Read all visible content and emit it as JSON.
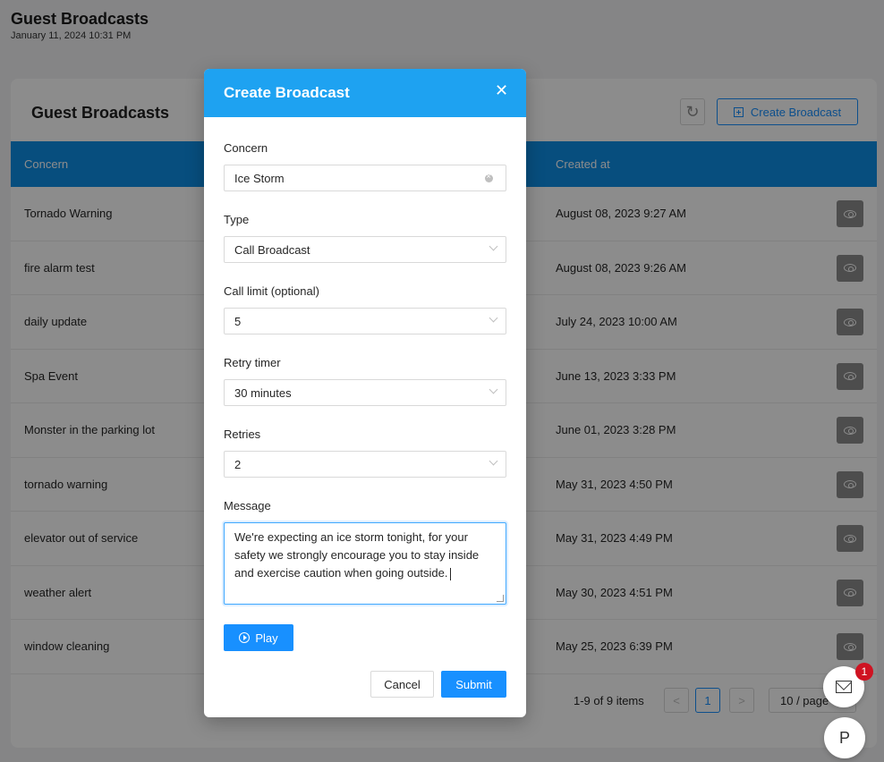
{
  "page": {
    "title": "Guest Broadcasts",
    "timestamp": "January 11, 2024 10:31 PM"
  },
  "card": {
    "title": "Guest Broadcasts",
    "create_label": "Create Broadcast",
    "columns": {
      "concern": "Concern",
      "created_at": "Created at"
    },
    "rows": [
      {
        "concern": "Tornado Warning",
        "created_at": "August 08, 2023 9:27 AM"
      },
      {
        "concern": "fire alarm test",
        "created_at": "August 08, 2023 9:26 AM"
      },
      {
        "concern": "daily update",
        "created_at": "July 24, 2023 10:00 AM"
      },
      {
        "concern": "Spa Event",
        "created_at": "June 13, 2023 3:33 PM"
      },
      {
        "concern": "Monster in the parking lot",
        "created_at": "June 01, 2023 3:28 PM"
      },
      {
        "concern": "tornado warning",
        "created_at": "May 31, 2023 4:50 PM"
      },
      {
        "concern": "elevator out of service",
        "created_at": "May 31, 2023 4:49 PM"
      },
      {
        "concern": "weather alert",
        "created_at": "May 30, 2023 4:51 PM"
      },
      {
        "concern": "window cleaning",
        "created_at": "May 25, 2023 6:39 PM"
      }
    ],
    "pagination": {
      "total": "1-9 of 9 items",
      "current": "1",
      "prev": "<",
      "next": ">",
      "page_size": "10 / page"
    }
  },
  "modal": {
    "title": "Create Broadcast",
    "close": "X",
    "concern_label": "Concern",
    "concern_value": "Ice Storm",
    "type_label": "Type",
    "type_value": "Call Broadcast",
    "call_limit_label": "Call limit (optional)",
    "call_limit_value": "5",
    "retry_timer_label": "Retry timer",
    "retry_timer_value": "30 minutes",
    "retries_label": "Retries",
    "retries_value": "2",
    "message_label": "Message",
    "message_value": "We're expecting an ice storm tonight, for your safety we strongly encourage you to stay inside and exercise caution when going outside.",
    "play_label": "Play",
    "cancel_label": "Cancel",
    "submit_label": "Submit"
  },
  "floating": {
    "mail_badge": "1",
    "avatar_initial": "P"
  },
  "colors": {
    "accent": "#1890ff",
    "header_blue": "#0e8ee6",
    "modal_header": "#1ea2f1",
    "badge_red": "#cf1322"
  },
  "icons": [
    "refresh-icon",
    "plus-square-icon",
    "eye-icon",
    "close-icon",
    "clear-icon",
    "chevron-down-icon",
    "play-circle-icon",
    "mail-icon"
  ]
}
